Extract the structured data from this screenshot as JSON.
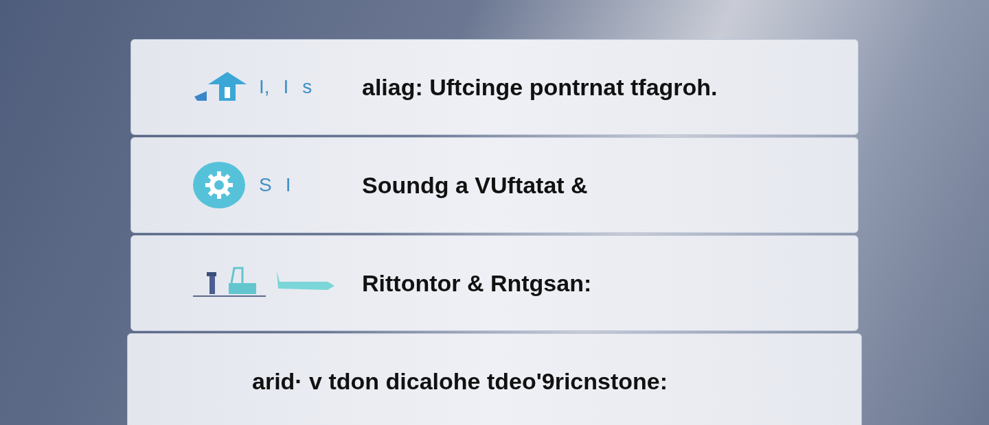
{
  "rows": [
    {
      "kind": "icon",
      "marks": [
        "I,",
        "I",
        "s"
      ],
      "label": "aliag: Uftcinge pontrnat tfagroh."
    },
    {
      "kind": "icon",
      "marks": [
        "S",
        "I"
      ],
      "label": "Soundg a VUftatat &"
    },
    {
      "kind": "icon",
      "marks": [],
      "label": "Rittontor & Rntgsan:"
    },
    {
      "kind": "text",
      "marks": [],
      "label": "arid· v tdon dicalohe tdeo'9ricnstone:"
    }
  ]
}
